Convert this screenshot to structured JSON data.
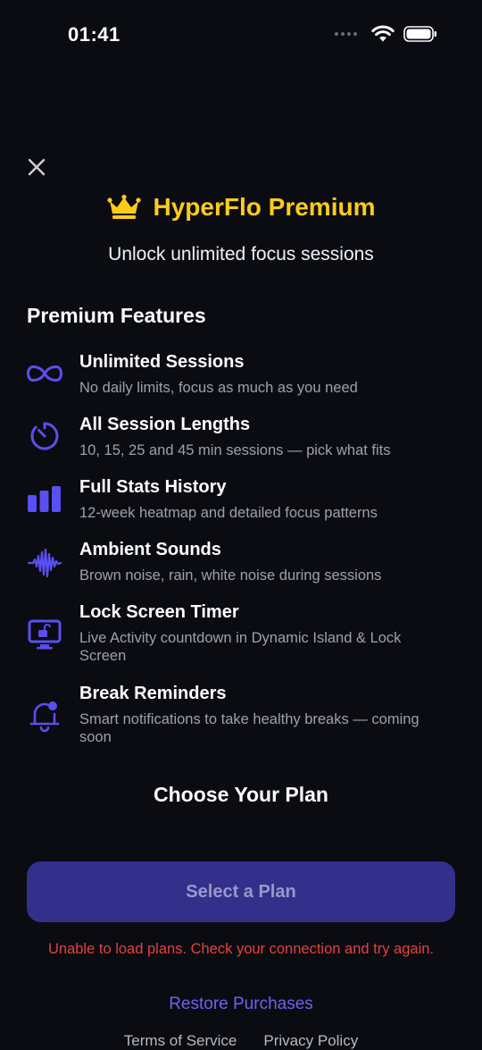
{
  "status_bar": {
    "time": "01:41"
  },
  "header": {
    "title": "HyperFlo Premium",
    "subtitle": "Unlock unlimited focus sessions",
    "title_color": "#ffcc1a"
  },
  "features": {
    "section_title": "Premium Features",
    "accent_color": "#5a4ff0",
    "items": [
      {
        "icon": "infinity-icon",
        "title": "Unlimited Sessions",
        "description": "No daily limits, focus as much as you need"
      },
      {
        "icon": "timer-icon",
        "title": "All Session Lengths",
        "description": "10, 15, 25 and 45 min sessions — pick what fits"
      },
      {
        "icon": "bar-chart-icon",
        "title": "Full Stats History",
        "description": "12-week heatmap and detailed focus patterns"
      },
      {
        "icon": "waveform-icon",
        "title": "Ambient Sounds",
        "description": "Brown noise, rain, white noise during sessions"
      },
      {
        "icon": "lock-screen-icon",
        "title": "Lock Screen Timer",
        "description": "Live Activity countdown in Dynamic Island & Lock Screen"
      },
      {
        "icon": "bell-badge-icon",
        "title": "Break Reminders",
        "description": "Smart notifications to take healthy breaks — coming soon"
      }
    ]
  },
  "plans": {
    "title": "Choose Your Plan",
    "select_button_label": "Select a Plan",
    "error_message": "Unable to load plans. Check your connection and try again."
  },
  "footer": {
    "restore_label": "Restore Purchases",
    "terms_label": "Terms of Service",
    "privacy_label": "Privacy Policy"
  }
}
